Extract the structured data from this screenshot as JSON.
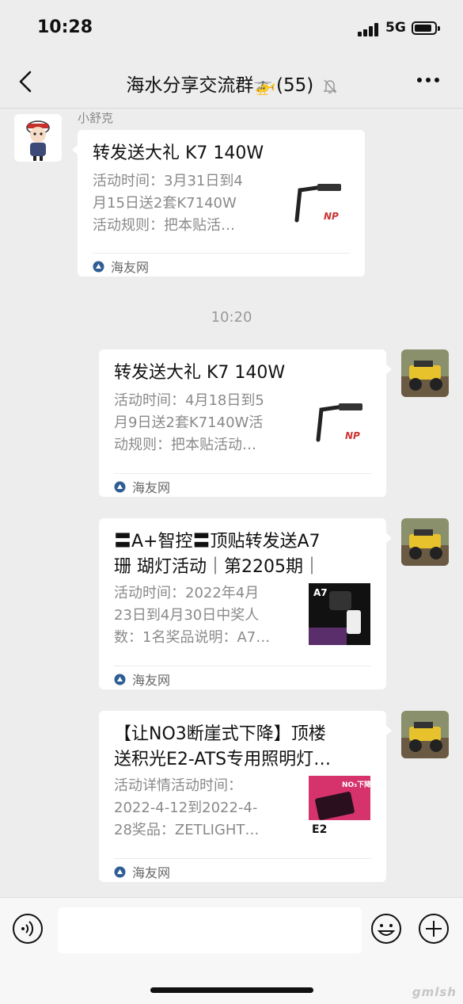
{
  "status_bar": {
    "time": "10:28",
    "network": "5G"
  },
  "header": {
    "title": "海水分享交流群🚁(55)"
  },
  "messages": [
    {
      "sender": "小舒克",
      "title": "转发送大礼 K7 140W",
      "desc_lines": [
        "活动时间：3月31日到4",
        "月15日送2套K7140W",
        "活动规则：把本贴活…"
      ],
      "thumb_text": "NP",
      "source": "海友网"
    },
    {
      "title": "转发送大礼 K7 140W",
      "desc_lines": [
        "活动时间：4月18日到5",
        "月9日送2套K7140W活",
        "动规则：把本贴活动…"
      ],
      "thumb_text": "NP",
      "source": "海友网"
    },
    {
      "title_lines": [
        "〓A+智控〓顶贴转发送A7",
        "珊 瑚灯活动｜第2205期｜"
      ],
      "desc_lines": [
        "活动时间：2022年4月",
        "23日到4月30日中奖人",
        "数：1名奖品说明：A7…"
      ],
      "thumb_text": "A7",
      "source": "海友网"
    },
    {
      "title_lines": [
        "【让NO3断崖式下降】顶楼",
        "送积光E2-ATS专用照明灯…"
      ],
      "desc_lines": [
        "活动详情活动时间：",
        "2022-4-12到2022-4-",
        "28奖品：ZETLIGHT…"
      ],
      "thumb_text": "E2",
      "thumb_sub": "NO₃下降",
      "source": "海友网"
    }
  ],
  "timestamp": "10:20",
  "watermark": "gmlsh",
  "colors": {
    "background": "#ededed",
    "bubble": "#ffffff",
    "muted_text": "#8a8a8a"
  }
}
